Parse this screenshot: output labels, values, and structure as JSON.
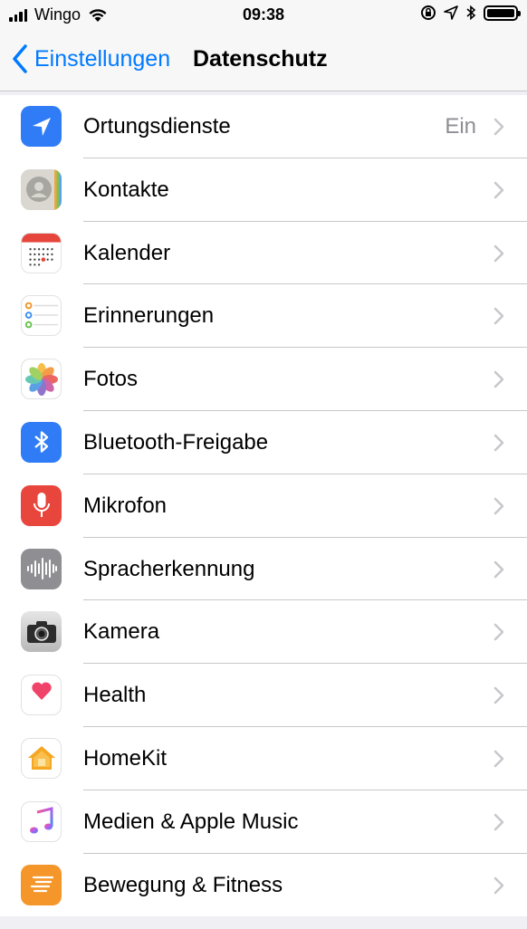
{
  "status_bar": {
    "carrier": "Wingo",
    "time": "09:38"
  },
  "nav": {
    "back_label": "Einstellungen",
    "title": "Datenschutz"
  },
  "rows": [
    {
      "label": "Ortungsdienste",
      "value": "Ein",
      "icon": "location-icon"
    },
    {
      "label": "Kontakte",
      "value": "",
      "icon": "contacts-icon"
    },
    {
      "label": "Kalender",
      "value": "",
      "icon": "calendar-icon"
    },
    {
      "label": "Erinnerungen",
      "value": "",
      "icon": "reminders-icon"
    },
    {
      "label": "Fotos",
      "value": "",
      "icon": "photos-icon"
    },
    {
      "label": "Bluetooth-Freigabe",
      "value": "",
      "icon": "bluetooth-icon"
    },
    {
      "label": "Mikrofon",
      "value": "",
      "icon": "microphone-icon"
    },
    {
      "label": "Spracherkennung",
      "value": "",
      "icon": "speech-recognition-icon"
    },
    {
      "label": "Kamera",
      "value": "",
      "icon": "camera-icon"
    },
    {
      "label": "Health",
      "value": "",
      "icon": "health-icon"
    },
    {
      "label": "HomeKit",
      "value": "",
      "icon": "homekit-icon"
    },
    {
      "label": "Medien & Apple Music",
      "value": "",
      "icon": "music-icon"
    },
    {
      "label": "Bewegung & Fitness",
      "value": "",
      "icon": "motion-fitness-icon"
    }
  ],
  "colors": {
    "accent": "#007aff",
    "separator": "#c8c7cc",
    "background": "#efeff4"
  }
}
